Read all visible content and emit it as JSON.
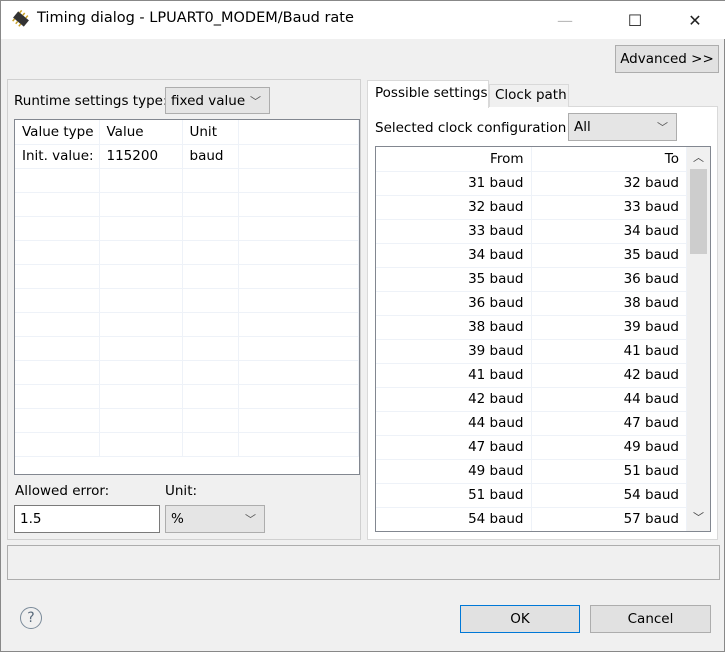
{
  "window": {
    "title": "Timing dialog - LPUART0_MODEM/Baud rate",
    "minimize": "—",
    "maximize": "☐",
    "close": "✕"
  },
  "advanced_label": "Advanced >>",
  "left": {
    "runtime_label": "Runtime settings type:",
    "runtime_value": "fixed value",
    "table": {
      "headers": [
        "Value type",
        "Value",
        "Unit"
      ],
      "rows": [
        [
          "Init. value:",
          "115200",
          "baud"
        ]
      ]
    },
    "allowed_error_label": "Allowed error:",
    "allowed_error_value": "1.5",
    "unit_label": "Unit:",
    "unit_value": "%"
  },
  "right": {
    "tabs": [
      {
        "label": "Possible settings",
        "active": true
      },
      {
        "label": "Clock path",
        "active": false
      }
    ],
    "config_label": "Selected clock configuration",
    "config_value": "All",
    "table": {
      "headers": [
        "From",
        "To"
      ],
      "rows": [
        [
          "31 baud",
          "32 baud"
        ],
        [
          "32 baud",
          "33 baud"
        ],
        [
          "33 baud",
          "34 baud"
        ],
        [
          "34 baud",
          "35 baud"
        ],
        [
          "35 baud",
          "36 baud"
        ],
        [
          "36 baud",
          "38 baud"
        ],
        [
          "38 baud",
          "39 baud"
        ],
        [
          "39 baud",
          "41 baud"
        ],
        [
          "41 baud",
          "42 baud"
        ],
        [
          "42 baud",
          "44 baud"
        ],
        [
          "44 baud",
          "47 baud"
        ],
        [
          "47 baud",
          "49 baud"
        ],
        [
          "49 baud",
          "51 baud"
        ],
        [
          "51 baud",
          "54 baud"
        ],
        [
          "54 baud",
          "57 baud"
        ]
      ]
    }
  },
  "buttons": {
    "ok": "OK",
    "cancel": "Cancel",
    "help": "?"
  }
}
